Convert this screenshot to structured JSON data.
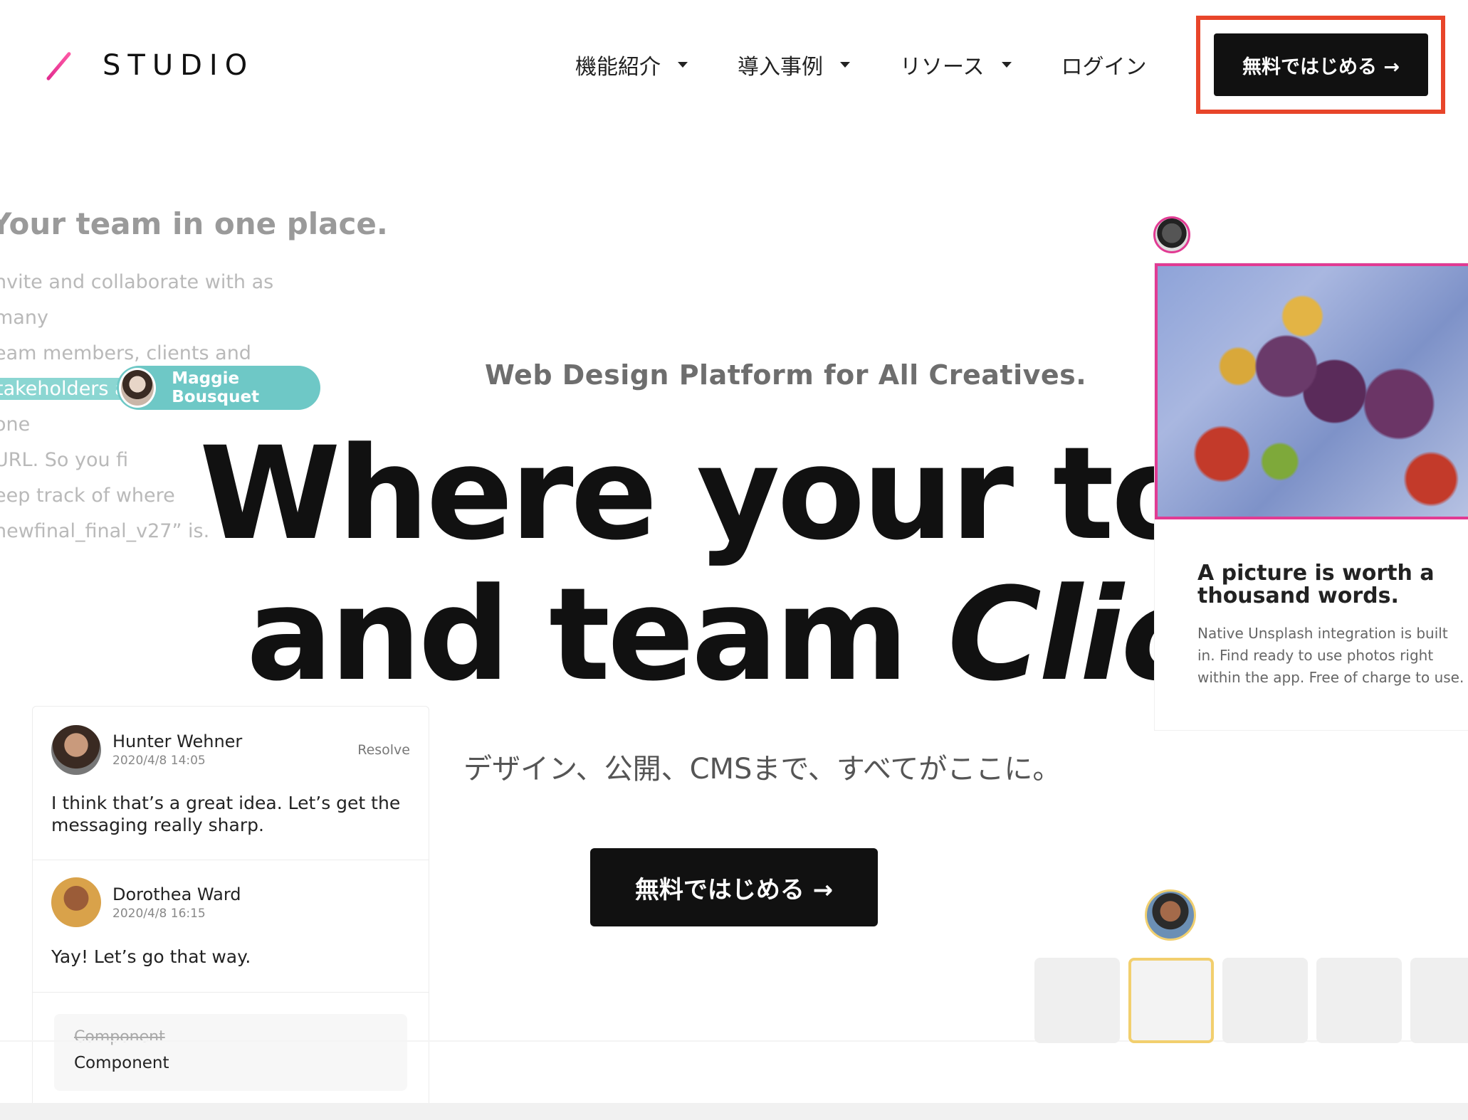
{
  "brand": {
    "name": "STUDIO",
    "accent": "#e13b93"
  },
  "nav": {
    "items": [
      {
        "label": "機能紹介",
        "icon": "caret-down-icon"
      },
      {
        "label": "導入事例",
        "icon": "caret-down-icon"
      },
      {
        "label": "リソース",
        "icon": "caret-down-icon"
      }
    ],
    "login": "ログイン",
    "cta": "無料ではじめる →"
  },
  "left_block": {
    "title": "Your team in one place.",
    "line1": "nvite and collaborate with as many",
    "line2": "eam members, clients and",
    "highlight": "takeholders as",
    "line3_rest": " needed. With one",
    "line4": "URL. So you fi",
    "line5": "eep track of where",
    "line6": "newfinal_final_v27” is.",
    "cursor_user": "Maggie Bousquet"
  },
  "hero": {
    "subtitle": "Web Design Platform for All Creatives.",
    "headline_line1": "Where your tools",
    "headline_line2_a": "and team ",
    "headline_line2_b": "Click.",
    "jp_sub": "デザイン、公開、CMSまで、すべてがここに。",
    "cta": "無料ではじめる →"
  },
  "photo_card": {
    "title": "A picture is worth a thousand words.",
    "body": "Native Unsplash integration is built in. Find ready to use photos right within the app. Free of charge to use."
  },
  "comments": [
    {
      "name": "Hunter Wehner",
      "time": "2020/4/8 14:05",
      "action": "Resolve",
      "text": "I think that’s a great idea. Let’s get the messaging really sharp."
    },
    {
      "name": "Dorothea Ward",
      "time": "2020/4/8 16:15",
      "text": "Yay! Let’s go that way."
    }
  ],
  "component": {
    "old": "Component",
    "new": "Component"
  }
}
